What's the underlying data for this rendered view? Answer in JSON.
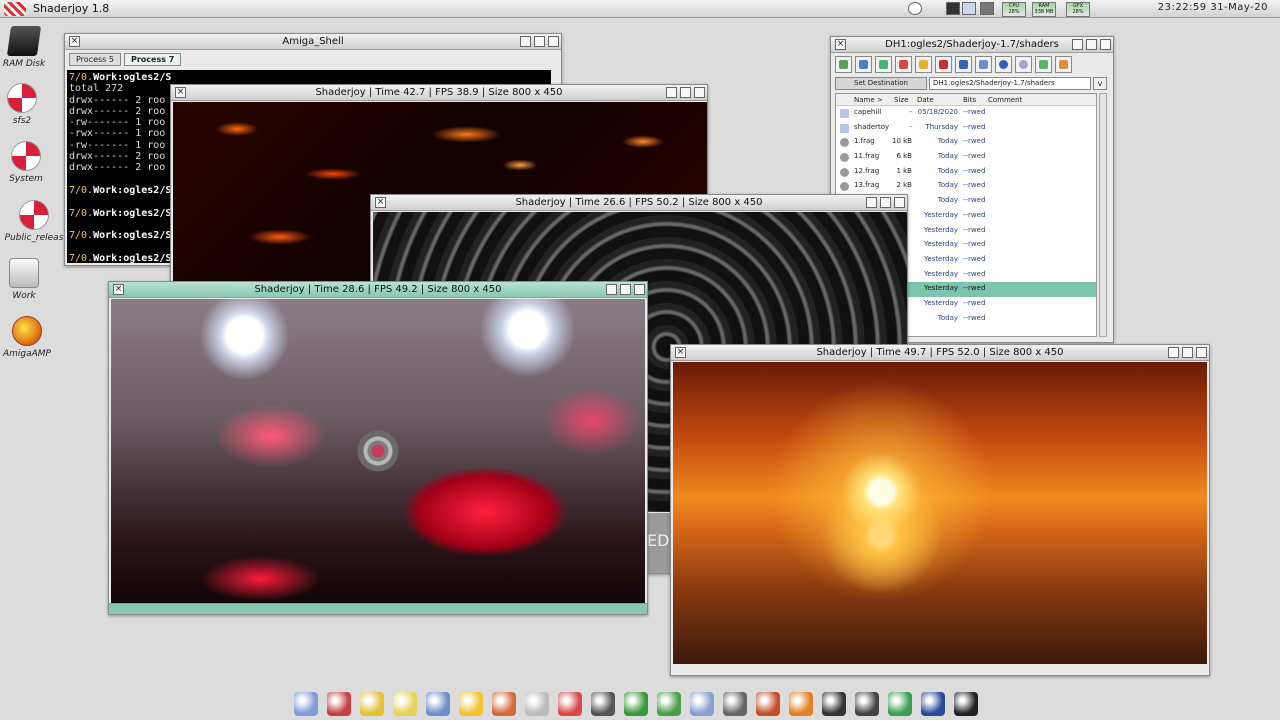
{
  "screen": {
    "title": "Shaderjoy 1.8",
    "clock": "23:22:59  31-May-20",
    "meters": [
      {
        "name": "CPU",
        "value": "28%"
      },
      {
        "name": "RAM",
        "value": "338 MB"
      },
      {
        "name": "GFX",
        "value": "28%"
      }
    ]
  },
  "desktop_icons": [
    {
      "label": "RAM Disk",
      "icon": "ram-disk-icon"
    },
    {
      "label": "sfs2",
      "icon": "boing-ball-icon"
    },
    {
      "label": "System",
      "icon": "boing-ball-icon"
    },
    {
      "label": "Public_releas",
      "icon": "boing-ball-icon"
    },
    {
      "label": "Work",
      "icon": "drive-icon"
    },
    {
      "label": "AmigaAMP",
      "icon": "amigaamp-icon"
    }
  ],
  "shell": {
    "title": "Amiga_Shell",
    "tabs": [
      "Process 5",
      "Process 7"
    ],
    "lines": [
      {
        "prompt": "7/0.",
        "text": "Work:ogles2/S"
      },
      {
        "text": "total 272"
      },
      {
        "text": "drwx------  2 roo"
      },
      {
        "text": "drwx------  2 roo"
      },
      {
        "text": "-rw-------  1 roo"
      },
      {
        "text": "-rwx------  1 roo"
      },
      {
        "text": "-rw-------  1 roo"
      },
      {
        "text": "drwx------  2 roo"
      },
      {
        "text": "drwx------  2 roo"
      },
      {
        "text": ""
      },
      {
        "prompt": "7/0.",
        "text": "Work:ogles2/S"
      },
      {
        "text": ""
      },
      {
        "prompt": "7/0.",
        "text": "Work:ogles2/S"
      },
      {
        "text": ""
      },
      {
        "prompt": "7/0.",
        "text": "Work:ogles2/S"
      },
      {
        "text": ""
      },
      {
        "prompt": "7/0.",
        "text": "Work:ogles2/S"
      }
    ]
  },
  "filer": {
    "title": "DH1:ogles2/Shaderjoy-1.7/shaders",
    "set_destination": "Set Destination",
    "path": "DH1:ogles2/Shaderjoy-1.7/shaders",
    "columns": [
      "Name >",
      "Size",
      "Date",
      "Bits",
      "Comment"
    ],
    "rows": [
      {
        "name": "capehill",
        "size": "-",
        "date": "05/18/2020",
        "bits": "--rwed",
        "type": "dir"
      },
      {
        "name": "shadertoy",
        "size": "-",
        "date": "Thursday",
        "bits": "--rwed",
        "type": "dir"
      },
      {
        "name": "1.frag",
        "size": "10 kB",
        "date": "Today",
        "bits": "--rwed",
        "type": "file"
      },
      {
        "name": "11.frag",
        "size": "6 kB",
        "date": "Today",
        "bits": "--rwed",
        "type": "file"
      },
      {
        "name": "12.frag",
        "size": "1 kB",
        "date": "Today",
        "bits": "--rwed",
        "type": "file"
      },
      {
        "name": "13.frag",
        "size": "2 kB",
        "date": "Today",
        "bits": "--rwed",
        "type": "file"
      },
      {
        "name": "",
        "size": "",
        "date": "Today",
        "bits": "--rwed",
        "type": "file"
      },
      {
        "name": "",
        "size": "",
        "date": "Yesterday",
        "bits": "--rwed",
        "type": "file"
      },
      {
        "name": "",
        "size": "",
        "date": "Yesterday",
        "bits": "--rwed",
        "type": "file"
      },
      {
        "name": "",
        "size": "",
        "date": "Yesterday",
        "bits": "--rwed",
        "type": "file"
      },
      {
        "name": "",
        "size": "",
        "date": "Yesterday",
        "bits": "--rwed",
        "type": "file"
      },
      {
        "name": "",
        "size": "",
        "date": "Yesterday",
        "bits": "--rwed",
        "type": "file"
      },
      {
        "name": "",
        "size": "",
        "date": "Yesterday",
        "bits": "--rwed",
        "type": "file",
        "selected": true
      },
      {
        "name": "",
        "size": "",
        "date": "Yesterday",
        "bits": "--rwed",
        "type": "file"
      },
      {
        "name": "",
        "size": "",
        "date": "Today",
        "bits": "--rwed",
        "type": "file"
      }
    ]
  },
  "shader_windows": [
    {
      "title": "Shaderjoy  |  Time 42.7  |  FPS 38.9  |  Size 800 x 450",
      "theme": "lava"
    },
    {
      "title": "Shaderjoy  |  Time 26.6  |  FPS 50.2  |  Size 800 x 450",
      "theme": "monochrome"
    },
    {
      "title": "Shaderjoy  |  Time 28.6  |  FPS 49.2  |  Size 800 x 450",
      "theme": "spirals",
      "active": true
    },
    {
      "title": "Shaderjoy  |  Time 49.7  |  FPS 52.0  |  Size 800 x 450",
      "theme": "sunset"
    }
  ],
  "behind_text": "ED",
  "dock_icons": [
    "sphere-icon",
    "magnifier-doc-icon",
    "sun-tool-icon",
    "lamp-icon",
    "window-icon",
    "palette-icon",
    "notepad-icon",
    "disc-icon",
    "monitor-icon",
    "search-icon",
    "pencil-icon",
    "spreadsheet-icon",
    "calculator-icon",
    "game-icon",
    "film-icon",
    "amigaamp-icon",
    "camera-icon",
    "computer-icon",
    "download-icon",
    "network-icon",
    "dosbox-icon"
  ],
  "colors": {
    "active_title": "#86c7b1",
    "selected_row": "#7dc4ac",
    "desktop": "#dcdcdc"
  }
}
